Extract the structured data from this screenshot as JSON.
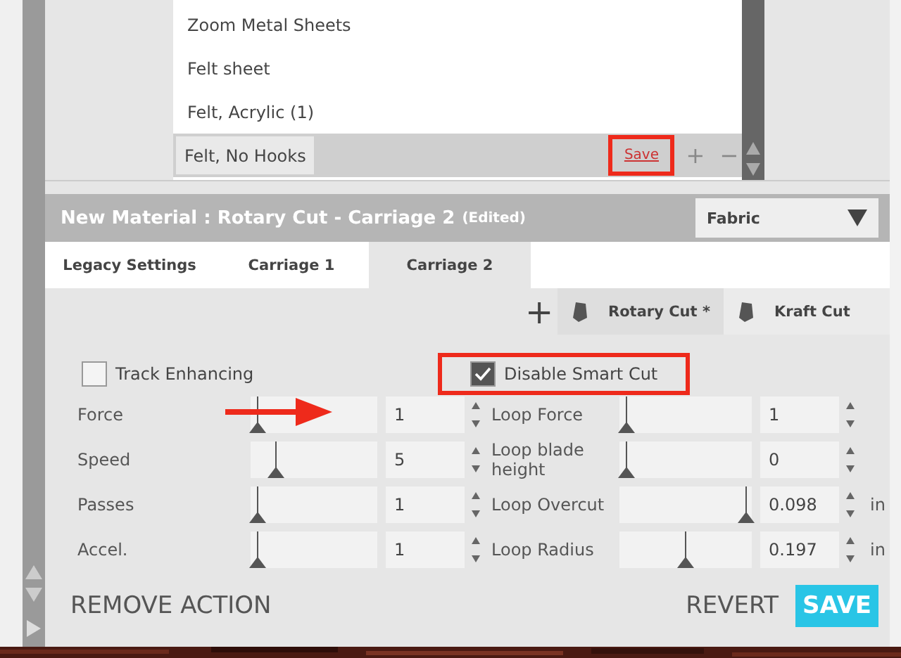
{
  "materials": {
    "items": [
      {
        "label": "Zoom Metal Sheets",
        "selected": false
      },
      {
        "label": "Felt sheet",
        "selected": false
      },
      {
        "label": "Felt, Acrylic (1)",
        "selected": false
      },
      {
        "label": "Felt, No Hooks",
        "selected": true
      }
    ],
    "save_link": {
      "label": "Save",
      "highlighted": true
    },
    "add": "+",
    "remove": "−"
  },
  "header": {
    "title": "New Material : Rotary Cut - Carriage 2",
    "note": "(Edited)",
    "category": "Fabric"
  },
  "tabs": [
    {
      "label": "Legacy Settings",
      "selected": false
    },
    {
      "label": "Carriage 1",
      "selected": false
    },
    {
      "label": "Carriage 2",
      "selected": true
    }
  ],
  "tools": {
    "add": "+",
    "items": [
      {
        "label": "Rotary Cut *",
        "selected": true
      },
      {
        "label": "Kraft Cut",
        "selected": false
      }
    ]
  },
  "options": [
    {
      "label": "Track Enhancing",
      "checked": false,
      "highlighted": false
    },
    {
      "label": "Disable Smart Cut",
      "checked": true,
      "highlighted": true
    }
  ],
  "settings_left": [
    {
      "label": "Force",
      "level": 0.05,
      "value": "1"
    },
    {
      "label": "Speed",
      "level": 0.2,
      "value": "5"
    },
    {
      "label": "Passes",
      "level": 0.05,
      "value": "1"
    },
    {
      "label": "Accel.",
      "level": 0.05,
      "value": "1"
    }
  ],
  "settings_right": [
    {
      "label": "Loop Force",
      "level": 0.05,
      "value": "1"
    },
    {
      "label": "Loop blade height",
      "level": 0.05,
      "value": "0"
    },
    {
      "label": "Loop Overcut",
      "level": 0.96,
      "value": "0.098",
      "unit": "in"
    },
    {
      "label": "Loop Radius",
      "level": 0.5,
      "value": "0.197",
      "unit": "in"
    }
  ],
  "footer": {
    "remove": "REMOVE ACTION",
    "revert": "REVERT",
    "save": "SAVE"
  }
}
